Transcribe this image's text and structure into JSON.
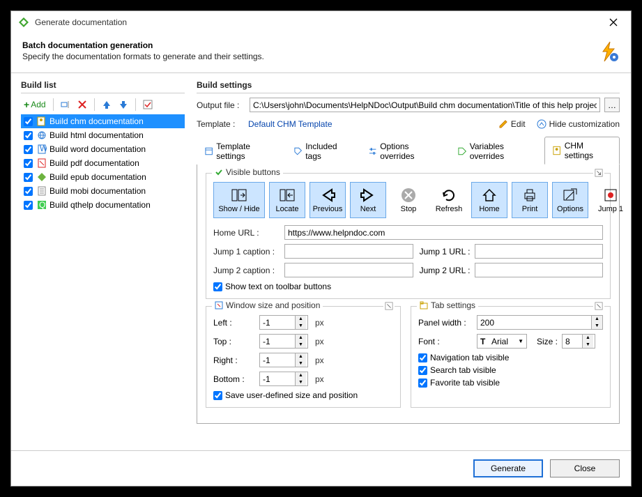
{
  "window": {
    "title": "Generate documentation"
  },
  "header": {
    "title": "Batch documentation generation",
    "subtitle": "Specify the documentation formats to generate and their settings."
  },
  "build_list": {
    "title": "Build list",
    "add_label": "Add",
    "items": [
      {
        "label": "Build chm documentation",
        "selected": true
      },
      {
        "label": "Build html documentation",
        "selected": false
      },
      {
        "label": "Build word documentation",
        "selected": false
      },
      {
        "label": "Build pdf documentation",
        "selected": false
      },
      {
        "label": "Build epub documentation",
        "selected": false
      },
      {
        "label": "Build mobi documentation",
        "selected": false
      },
      {
        "label": "Build qthelp documentation",
        "selected": false
      }
    ]
  },
  "settings": {
    "title": "Build settings",
    "output_label": "Output file :",
    "output_value": "C:\\Users\\john\\Documents\\HelpNDoc\\Output\\Build chm documentation\\Title of this help project.chm",
    "template_label": "Template :",
    "template_value": "Default CHM Template",
    "edit_label": "Edit",
    "hide_label": "Hide customization",
    "tabs": [
      {
        "label": "Template settings"
      },
      {
        "label": "Included tags"
      },
      {
        "label": "Options overrides"
      },
      {
        "label": "Variables overrides"
      },
      {
        "label": "CHM settings"
      }
    ]
  },
  "chm": {
    "visible_buttons_title": "Visible buttons",
    "buttons": {
      "show_hide": "Show / Hide",
      "locate": "Locate",
      "previous": "Previous",
      "next": "Next",
      "stop": "Stop",
      "refresh": "Refresh",
      "home": "Home",
      "print": "Print",
      "options": "Options",
      "jump1": "Jump 1"
    },
    "home_url_label": "Home URL :",
    "home_url_value": "https://www.helpndoc.com",
    "jump1_caption_label": "Jump 1 caption :",
    "jump1_url_label": "Jump 1 URL :",
    "jump2_caption_label": "Jump 2 caption :",
    "jump2_url_label": "Jump 2 URL :",
    "show_text_label": "Show text on toolbar buttons",
    "window_group_title": "Window size and position",
    "left_label": "Left :",
    "top_label": "Top :",
    "right_label": "Right :",
    "bottom_label": "Bottom :",
    "neg1": "-1",
    "px": "px",
    "save_size_label": "Save user-defined size and position",
    "tab_group_title": "Tab settings",
    "panel_width_label": "Panel width :",
    "panel_width_value": "200",
    "font_label": "Font :",
    "font_value": "Arial",
    "size_label": "Size :",
    "size_value": "8",
    "nav_tab_label": "Navigation tab visible",
    "search_tab_label": "Search tab visible",
    "fav_tab_label": "Favorite tab visible"
  },
  "footer": {
    "generate": "Generate",
    "close": "Close"
  }
}
